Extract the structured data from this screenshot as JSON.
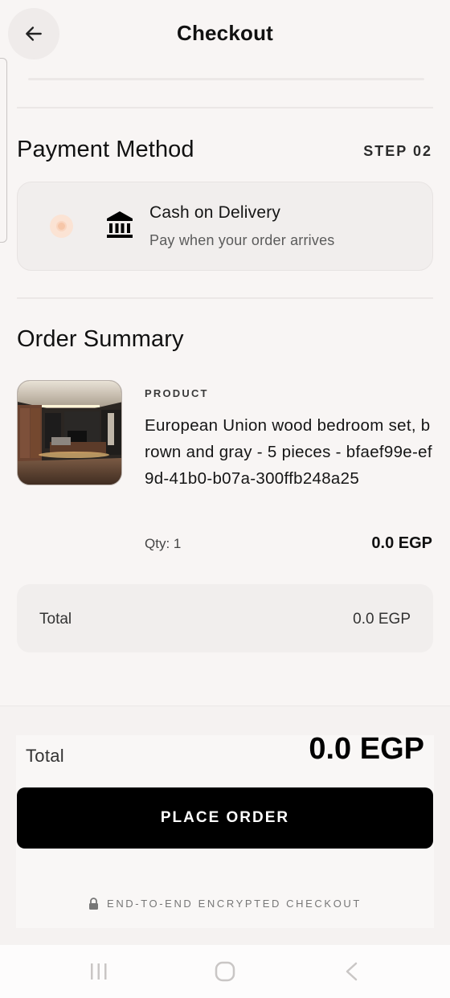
{
  "header": {
    "title": "Checkout"
  },
  "payment": {
    "title": "Payment Method",
    "step": "STEP 02",
    "method": {
      "title": "Cash on Delivery",
      "subtitle": "Pay when your order arrives",
      "selected": true
    }
  },
  "summary": {
    "title": "Order Summary",
    "item": {
      "kicker": "PRODUCT",
      "name": "European Union wood bedroom set, brown and gray - 5 pieces - bfaef99e-ef9d-41b0-b07a-300ffb248a25",
      "qty": "Qty: 1",
      "price": "0.0 EGP"
    },
    "total_label": "Total",
    "total_value": "0.0 EGP"
  },
  "footer": {
    "total_label": "Total",
    "total_value": "0.0 EGP",
    "place_order": "PLACE ORDER",
    "secure_note": "END-TO-END ENCRYPTED CHECKOUT"
  },
  "colors": {
    "accent": "#f6c6a8",
    "button": "#000000",
    "background": "#f8f5f4"
  },
  "icons": {
    "back": "arrow-left-icon",
    "bank": "bank-icon",
    "lock": "lock-icon"
  }
}
